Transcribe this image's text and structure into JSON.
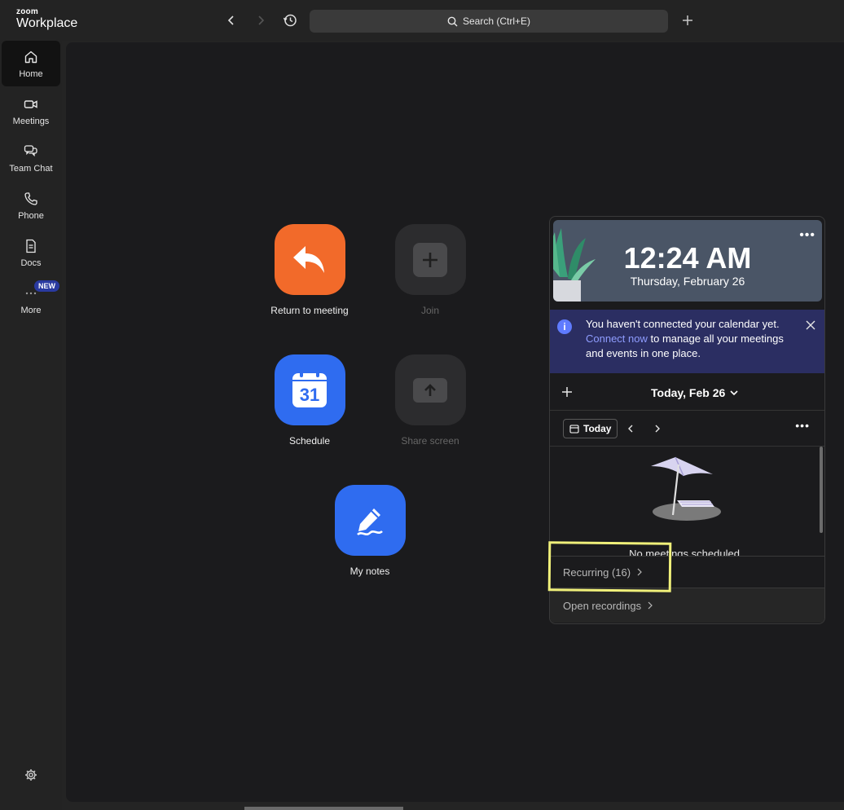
{
  "app": {
    "brand_small": "zoom",
    "brand_large": "Workplace"
  },
  "topbar": {
    "search_placeholder": "Search (Ctrl+E)"
  },
  "sidebar": {
    "items": [
      {
        "label": "Home",
        "icon": "home-icon"
      },
      {
        "label": "Meetings",
        "icon": "video-icon"
      },
      {
        "label": "Team Chat",
        "icon": "chat-icon"
      },
      {
        "label": "Phone",
        "icon": "phone-icon"
      },
      {
        "label": "Docs",
        "icon": "docs-icon"
      },
      {
        "label": "More",
        "icon": "more-icon",
        "badge": "NEW"
      }
    ]
  },
  "actions": {
    "return_label": "Return to meeting",
    "join_label": "Join",
    "schedule_label": "Schedule",
    "schedule_day": "31",
    "share_label": "Share screen",
    "notes_label": "My notes"
  },
  "calendar": {
    "time": "12:24 AM",
    "date": "Thursday, February 26",
    "banner_text_1": "You haven't connected your calendar yet.",
    "banner_link": "Connect now",
    "banner_text_2": " to manage all your meetings and events in one place.",
    "day_title": "Today, Feb 26",
    "today_button": "Today",
    "empty_message": "No meetings scheduled",
    "recurring": "Recurring (16)",
    "open_recordings": "Open recordings"
  },
  "colors": {
    "accent_orange": "#f26a2a",
    "accent_blue": "#2f6cf0",
    "banner": "#2b2e62",
    "highlight": "#f0f07a"
  }
}
